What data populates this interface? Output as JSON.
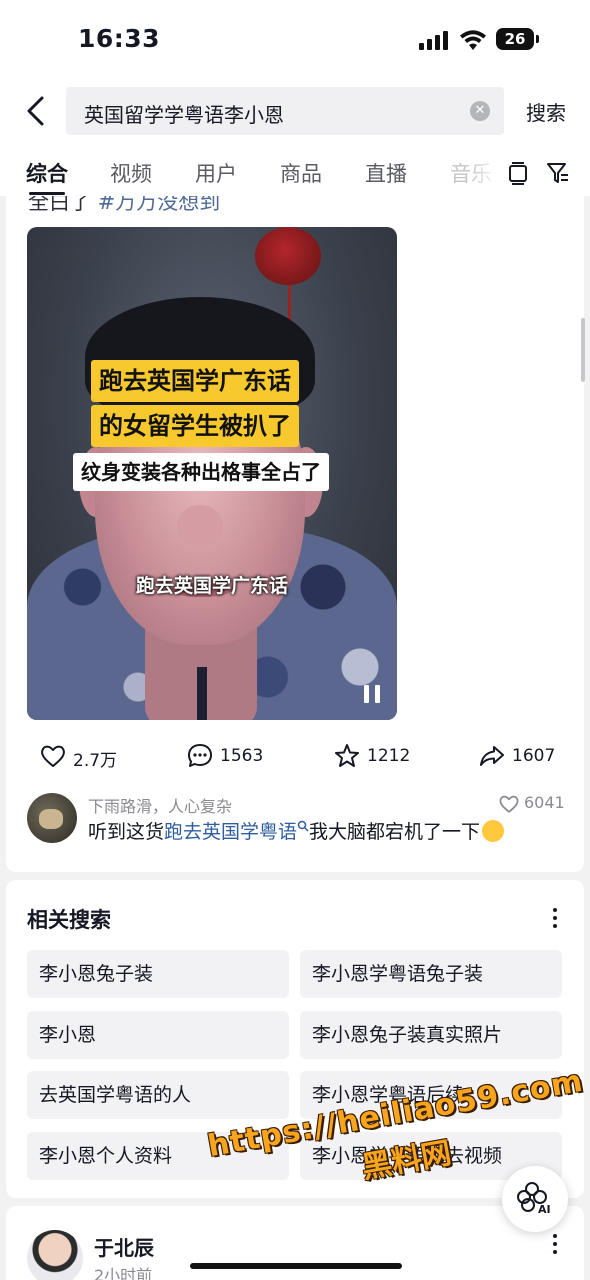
{
  "status_bar": {
    "time": "16:33",
    "battery": "26"
  },
  "search": {
    "query": "英国留学学粤语李小恩",
    "clear_icon": "close-circle-icon",
    "submit_label": "搜索"
  },
  "tabs": [
    "综合",
    "视频",
    "用户",
    "商品",
    "直播",
    "音乐"
  ],
  "active_tab": "综合",
  "post": {
    "cut_text": "全白了",
    "cut_tag": "#万万没想到",
    "caption_line1": "跑去英国学广东话",
    "caption_line2": "的女留学生被扒了",
    "caption_line3": "纹身变装各种出格事全占了",
    "subtitle": "跑去英国学广东话",
    "likes": "2.7万",
    "comments": "1563",
    "favorites": "1212",
    "shares": "1607"
  },
  "top_comment": {
    "author": "下雨路滑，人心复杂",
    "likes": "6041",
    "text_before": "听到这货",
    "link_text": "跑去英国学粤语",
    "text_after": "我大脑都宕机了一下"
  },
  "related": {
    "title": "相关搜索",
    "items": [
      "李小恩兔子装",
      "李小恩学粤语兔子装",
      "李小恩",
      "李小恩兔子装真实照片",
      "去英国学粤语的人",
      "李小恩学粤语后续",
      "李小恩个人资料",
      "李小恩学粤语回去视频"
    ]
  },
  "next_post": {
    "author": "于北辰",
    "time": "2小时前"
  },
  "ai_button": {
    "label": "AI"
  },
  "watermark": {
    "url": "https://heiliao59.com",
    "name": "黑料网"
  },
  "colors": {
    "accent_link": "#2e5c9e",
    "caption_yellow": "#f7c92c",
    "watermark": "#f7a51c"
  }
}
